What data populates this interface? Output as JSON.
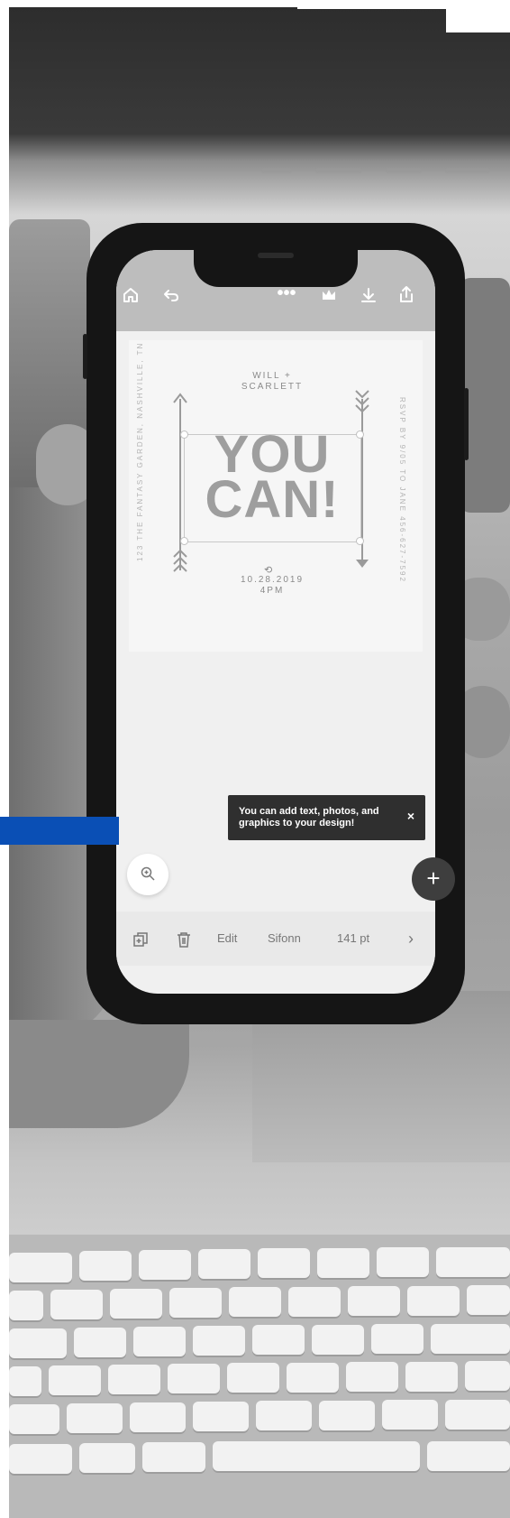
{
  "toolbar": {
    "icons": [
      "home-icon",
      "undo-icon",
      "more-icon",
      "crown-icon",
      "download-icon",
      "share-icon"
    ],
    "more_label": "•••",
    "page_menu_label": "•••"
  },
  "design": {
    "left_text": "123 THE FANTASY GARDEN, NASHVILLE, TN",
    "right_text": "RSVP BY 9/05 TO JANE 456-627-7592",
    "names_line1": "WILL +",
    "names_line2": "SCARLETT",
    "headline_line1": "YOU",
    "headline_line2": "CAN!",
    "date": "10.28.2019",
    "time": "4PM"
  },
  "tooltip": {
    "text": "You can add text, photos, and graphics to your design!",
    "close": "×"
  },
  "bottom_bar": {
    "edit": "Edit",
    "font": "Sifonn",
    "size": "141 pt",
    "next": "›"
  },
  "colors": {
    "accent_bar": "#0A4FB5",
    "tooltip_bg": "#2F2F2F",
    "add_button": "#3E3E3E"
  }
}
